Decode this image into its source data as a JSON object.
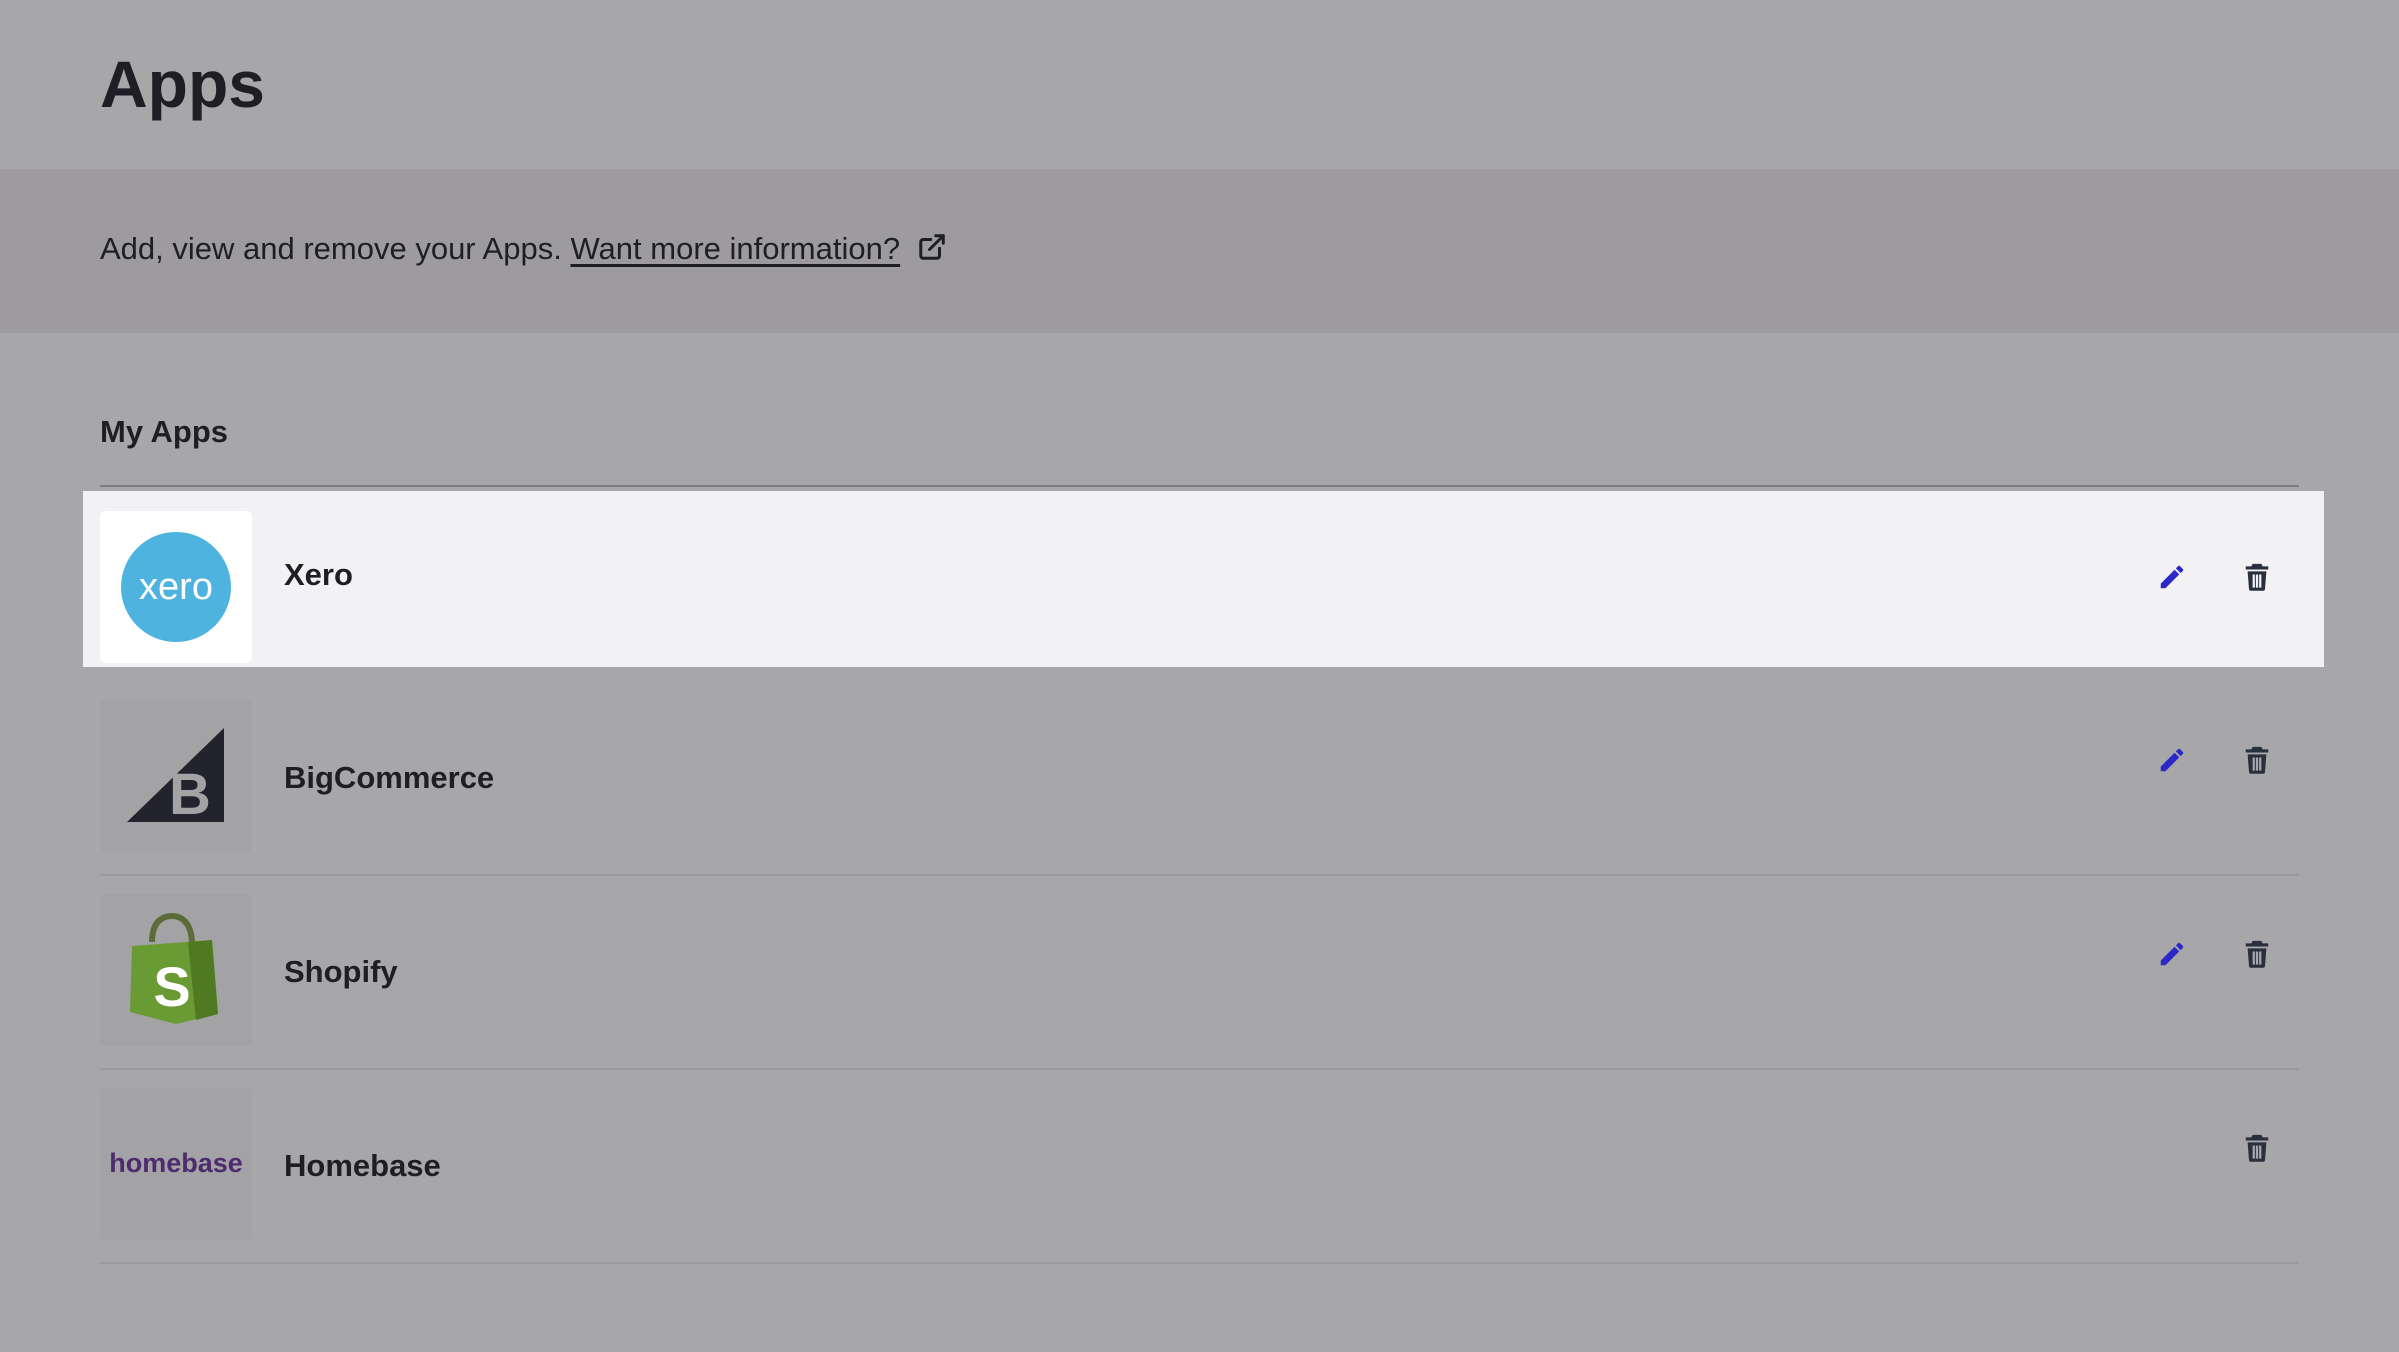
{
  "page": {
    "title": "Apps"
  },
  "info": {
    "text": "Add, view and remove your Apps.",
    "link_label": "Want more information?",
    "link_icon": "external-link-icon"
  },
  "section": {
    "title": "My Apps"
  },
  "apps": [
    {
      "name": "Xero",
      "logo_text": "xero",
      "logo_color": "#4fb3e0",
      "editable": true,
      "deletable": true,
      "highlighted": true
    },
    {
      "name": "BigCommerce",
      "logo_text": "B",
      "logo_color": "#23232d",
      "editable": true,
      "deletable": true,
      "highlighted": false
    },
    {
      "name": "Shopify",
      "logo_text": "S",
      "logo_color": "#6a9a33",
      "editable": true,
      "deletable": true,
      "highlighted": false
    },
    {
      "name": "Homebase",
      "logo_text": "homebase",
      "logo_color": "#4e2a6e",
      "editable": false,
      "deletable": true,
      "highlighted": false
    }
  ],
  "icons": {
    "edit": "pencil-icon",
    "delete": "trash-icon"
  },
  "colors": {
    "accent": "#2c28c7",
    "icon_dark": "#2a2f3d",
    "background": "#a7a7a9",
    "band": "#9d9b9e",
    "highlight_row": "#f2f1f4"
  }
}
